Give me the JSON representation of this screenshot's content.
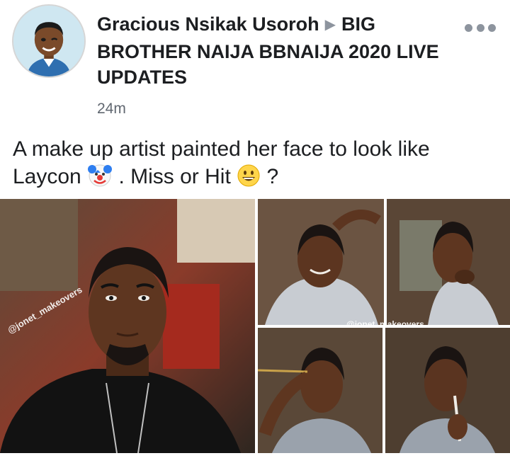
{
  "post": {
    "author": "Gracious Nsikak Usoroh",
    "group": "BIG BROTHER NAIJA BBNAIJA 2020 LIVE UPDATES",
    "timestamp": "24m",
    "caption_part1": "A make up artist painted her face to look like Laycon",
    "caption_part2": ". Miss or Hit",
    "caption_part3": "?",
    "emoji1": "clown-face",
    "emoji2": "grinning-face"
  },
  "photos": {
    "watermark": "@jonet_makeovers"
  },
  "colors": {
    "title_text": "#1c1e21",
    "secondary_text": "#606770",
    "icon_gray": "#8d949e"
  }
}
